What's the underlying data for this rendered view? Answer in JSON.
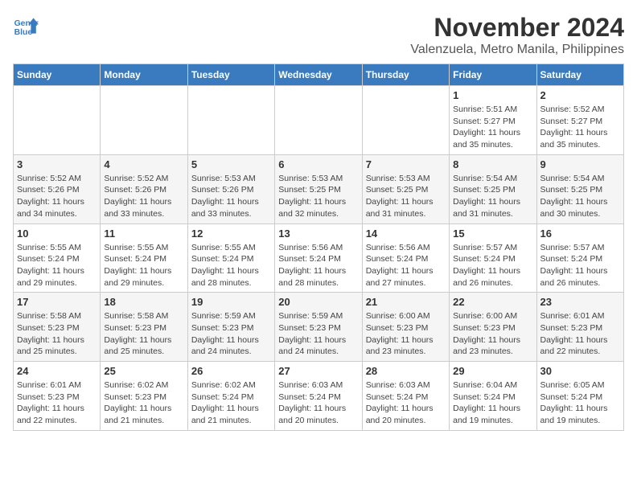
{
  "logo": {
    "line1": "General",
    "line2": "Blue"
  },
  "title": "November 2024",
  "location": "Valenzuela, Metro Manila, Philippines",
  "days_of_week": [
    "Sunday",
    "Monday",
    "Tuesday",
    "Wednesday",
    "Thursday",
    "Friday",
    "Saturday"
  ],
  "weeks": [
    [
      {
        "day": "",
        "info": ""
      },
      {
        "day": "",
        "info": ""
      },
      {
        "day": "",
        "info": ""
      },
      {
        "day": "",
        "info": ""
      },
      {
        "day": "",
        "info": ""
      },
      {
        "day": "1",
        "info": "Sunrise: 5:51 AM\nSunset: 5:27 PM\nDaylight: 11 hours\nand 35 minutes."
      },
      {
        "day": "2",
        "info": "Sunrise: 5:52 AM\nSunset: 5:27 PM\nDaylight: 11 hours\nand 35 minutes."
      }
    ],
    [
      {
        "day": "3",
        "info": "Sunrise: 5:52 AM\nSunset: 5:26 PM\nDaylight: 11 hours\nand 34 minutes."
      },
      {
        "day": "4",
        "info": "Sunrise: 5:52 AM\nSunset: 5:26 PM\nDaylight: 11 hours\nand 33 minutes."
      },
      {
        "day": "5",
        "info": "Sunrise: 5:53 AM\nSunset: 5:26 PM\nDaylight: 11 hours\nand 33 minutes."
      },
      {
        "day": "6",
        "info": "Sunrise: 5:53 AM\nSunset: 5:25 PM\nDaylight: 11 hours\nand 32 minutes."
      },
      {
        "day": "7",
        "info": "Sunrise: 5:53 AM\nSunset: 5:25 PM\nDaylight: 11 hours\nand 31 minutes."
      },
      {
        "day": "8",
        "info": "Sunrise: 5:54 AM\nSunset: 5:25 PM\nDaylight: 11 hours\nand 31 minutes."
      },
      {
        "day": "9",
        "info": "Sunrise: 5:54 AM\nSunset: 5:25 PM\nDaylight: 11 hours\nand 30 minutes."
      }
    ],
    [
      {
        "day": "10",
        "info": "Sunrise: 5:55 AM\nSunset: 5:24 PM\nDaylight: 11 hours\nand 29 minutes."
      },
      {
        "day": "11",
        "info": "Sunrise: 5:55 AM\nSunset: 5:24 PM\nDaylight: 11 hours\nand 29 minutes."
      },
      {
        "day": "12",
        "info": "Sunrise: 5:55 AM\nSunset: 5:24 PM\nDaylight: 11 hours\nand 28 minutes."
      },
      {
        "day": "13",
        "info": "Sunrise: 5:56 AM\nSunset: 5:24 PM\nDaylight: 11 hours\nand 28 minutes."
      },
      {
        "day": "14",
        "info": "Sunrise: 5:56 AM\nSunset: 5:24 PM\nDaylight: 11 hours\nand 27 minutes."
      },
      {
        "day": "15",
        "info": "Sunrise: 5:57 AM\nSunset: 5:24 PM\nDaylight: 11 hours\nand 26 minutes."
      },
      {
        "day": "16",
        "info": "Sunrise: 5:57 AM\nSunset: 5:24 PM\nDaylight: 11 hours\nand 26 minutes."
      }
    ],
    [
      {
        "day": "17",
        "info": "Sunrise: 5:58 AM\nSunset: 5:23 PM\nDaylight: 11 hours\nand 25 minutes."
      },
      {
        "day": "18",
        "info": "Sunrise: 5:58 AM\nSunset: 5:23 PM\nDaylight: 11 hours\nand 25 minutes."
      },
      {
        "day": "19",
        "info": "Sunrise: 5:59 AM\nSunset: 5:23 PM\nDaylight: 11 hours\nand 24 minutes."
      },
      {
        "day": "20",
        "info": "Sunrise: 5:59 AM\nSunset: 5:23 PM\nDaylight: 11 hours\nand 24 minutes."
      },
      {
        "day": "21",
        "info": "Sunrise: 6:00 AM\nSunset: 5:23 PM\nDaylight: 11 hours\nand 23 minutes."
      },
      {
        "day": "22",
        "info": "Sunrise: 6:00 AM\nSunset: 5:23 PM\nDaylight: 11 hours\nand 23 minutes."
      },
      {
        "day": "23",
        "info": "Sunrise: 6:01 AM\nSunset: 5:23 PM\nDaylight: 11 hours\nand 22 minutes."
      }
    ],
    [
      {
        "day": "24",
        "info": "Sunrise: 6:01 AM\nSunset: 5:23 PM\nDaylight: 11 hours\nand 22 minutes."
      },
      {
        "day": "25",
        "info": "Sunrise: 6:02 AM\nSunset: 5:23 PM\nDaylight: 11 hours\nand 21 minutes."
      },
      {
        "day": "26",
        "info": "Sunrise: 6:02 AM\nSunset: 5:24 PM\nDaylight: 11 hours\nand 21 minutes."
      },
      {
        "day": "27",
        "info": "Sunrise: 6:03 AM\nSunset: 5:24 PM\nDaylight: 11 hours\nand 20 minutes."
      },
      {
        "day": "28",
        "info": "Sunrise: 6:03 AM\nSunset: 5:24 PM\nDaylight: 11 hours\nand 20 minutes."
      },
      {
        "day": "29",
        "info": "Sunrise: 6:04 AM\nSunset: 5:24 PM\nDaylight: 11 hours\nand 19 minutes."
      },
      {
        "day": "30",
        "info": "Sunrise: 6:05 AM\nSunset: 5:24 PM\nDaylight: 11 hours\nand 19 minutes."
      }
    ]
  ]
}
